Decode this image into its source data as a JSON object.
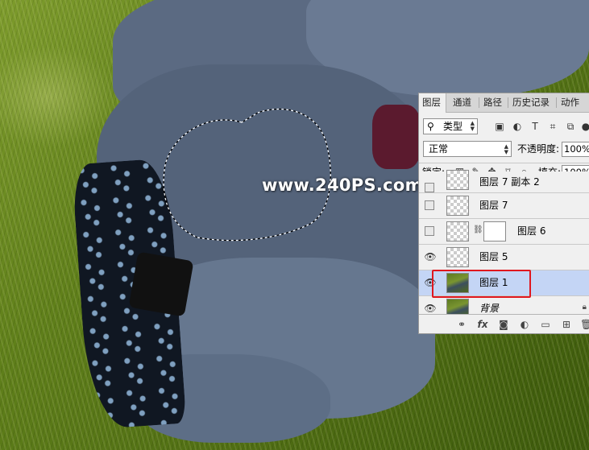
{
  "watermark": "www.240PS.com",
  "panel": {
    "tabs": [
      "图层",
      "通道",
      "路径",
      "历史记录",
      "动作"
    ],
    "filter": {
      "icon_glyph": "⚲",
      "label": "类型"
    },
    "blend_mode": "正常",
    "opacity_label": "不透明度:",
    "opacity_value": "100%",
    "lock_label": "锁定:",
    "fill_label": "填充:",
    "fill_value": "100%",
    "layers": [
      {
        "name": "图层 7 副本 2",
        "visible": false,
        "thumb": "transparent",
        "selected": false,
        "italic": false
      },
      {
        "name": "图层 7",
        "visible": false,
        "thumb": "transparent",
        "selected": false,
        "italic": false
      },
      {
        "name": "图层 6",
        "visible": false,
        "thumb": "transparent-mask",
        "selected": false,
        "italic": false
      },
      {
        "name": "图层 5",
        "visible": true,
        "thumb": "transparent",
        "selected": false,
        "italic": false
      },
      {
        "name": "图层 1",
        "visible": true,
        "thumb": "photo",
        "selected": true,
        "italic": false
      },
      {
        "name": "背景",
        "visible": true,
        "thumb": "photo",
        "selected": false,
        "italic": true
      }
    ],
    "bottom_icons": [
      "link-icon",
      "fx-icon",
      "mask-icon",
      "adjustment-icon",
      "group-icon",
      "new-layer-icon",
      "trash-icon"
    ],
    "bottom_fx_label": "fx"
  },
  "colors": {
    "highlight": "#e0171e",
    "selected_row": "#c4d5f5"
  }
}
